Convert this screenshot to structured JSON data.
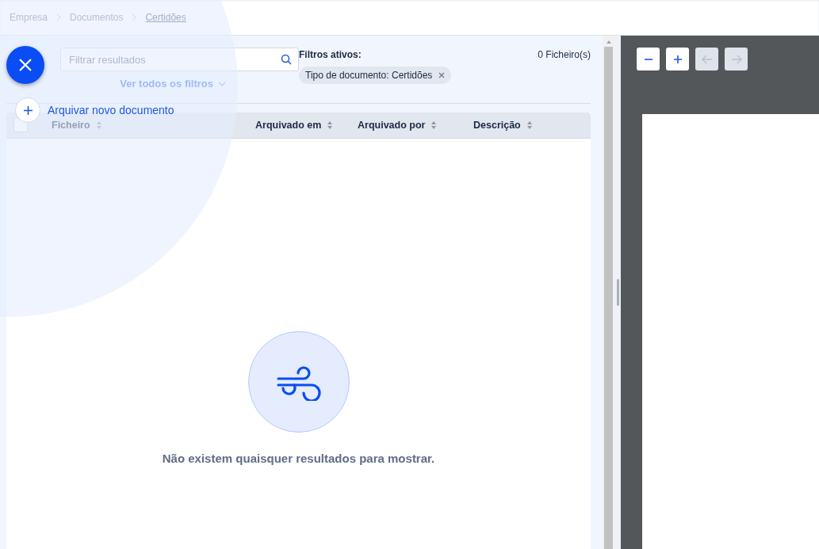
{
  "breadcrumb": [
    {
      "label": "Empresa",
      "current": false
    },
    {
      "label": "Documentos",
      "current": false
    },
    {
      "label": "Certidões",
      "current": true
    }
  ],
  "search": {
    "placeholder": "Filtrar resultados"
  },
  "filters_toggle": "Ver todos os filtros",
  "active_filters": {
    "label": "Filtros ativos:",
    "count": "0 Ficheiro(s)",
    "chips": [
      {
        "name": "Tipo de documento:",
        "value": "Certidões"
      }
    ]
  },
  "table": {
    "select_all_checked": false,
    "columns": [
      {
        "label": "Ficheiro"
      },
      {
        "label": "Arquivado em"
      },
      {
        "label": "Arquivado por"
      },
      {
        "label": "Descrição"
      }
    ]
  },
  "empty_message": "Não existem quaisquer resultados para mostrar.",
  "viewer": {
    "buttons": [
      {
        "kind": "minus",
        "disabled": false
      },
      {
        "kind": "plus",
        "disabled": false
      },
      {
        "kind": "prev",
        "disabled": true
      },
      {
        "kind": "next",
        "disabled": true
      }
    ]
  },
  "fab_menu": {
    "expanded": true,
    "actions": [
      {
        "label": "Arquivar novo documento"
      }
    ]
  }
}
